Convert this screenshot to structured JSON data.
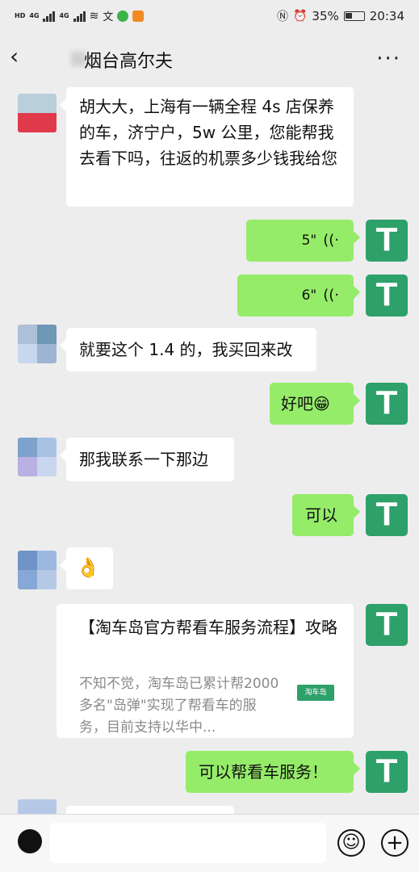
{
  "status_bar": {
    "left_labels": [
      "HD",
      "HD",
      "4G",
      "4G"
    ],
    "battery": "35%",
    "time": "20:34"
  },
  "header": {
    "title": "烟台高尔夫",
    "more": "···",
    "back": "‹"
  },
  "messages": [
    {
      "side": "left",
      "text": "胡大大，上海有一辆全程 4s 店保养的车，济宁户，5w 公里，您能帮我去看下吗，往返的机票多少钱我给您"
    },
    {
      "side": "right",
      "type": "voice",
      "duration": "5\""
    },
    {
      "side": "right",
      "type": "voice",
      "duration": "6\""
    },
    {
      "side": "left",
      "text": "就要这个 1.4 的，我买回来改"
    },
    {
      "side": "right",
      "text": "好吧😁"
    },
    {
      "side": "left",
      "text": "那我联系一下那边"
    },
    {
      "side": "right",
      "text": "可以"
    },
    {
      "side": "left",
      "text": "👌"
    },
    {
      "side": "right",
      "type": "card",
      "title": "【淘车岛官方帮看车服务流程】攻略",
      "desc": "不知不觉，淘车岛已累计帮2000多名\"岛弹\"实现了帮看车的服务，目前支持以华中...",
      "logo": "淘车岛"
    },
    {
      "side": "right",
      "text": "可以帮看车服务！"
    }
  ],
  "avatar_right_letter": "T",
  "input_bar": {
    "placeholder": "",
    "emoji_icon": "☺",
    "plus_icon": "+"
  },
  "colors": {
    "bg": "#ededed",
    "bubble_right": "#95ec69",
    "bubble_left": "#ffffff",
    "avatar_right": "#2ea06a"
  }
}
